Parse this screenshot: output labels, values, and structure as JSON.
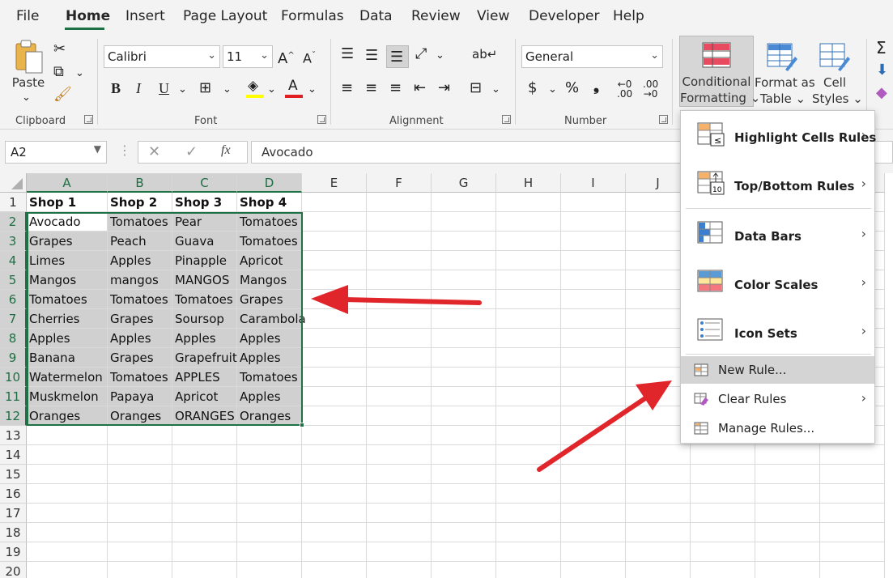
{
  "tabs": [
    "File",
    "Home",
    "Insert",
    "Page Layout",
    "Formulas",
    "Data",
    "Review",
    "View",
    "Developer",
    "Help"
  ],
  "ribbon": {
    "clipboard": {
      "label": "Clipboard",
      "paste": "Paste"
    },
    "font": {
      "label": "Font",
      "name": "Calibri",
      "size": "11",
      "bold": "B",
      "italic": "I",
      "underline": "U"
    },
    "alignment": {
      "label": "Alignment"
    },
    "number": {
      "label": "Number",
      "format": "General",
      "currency": "$",
      "percent": "%",
      "comma": "❟"
    },
    "styles": {
      "conditional_formatting": [
        "Conditional",
        "Formatting"
      ],
      "format_as_table": [
        "Format as",
        "Table"
      ],
      "cell_styles": [
        "Cell",
        "Styles"
      ]
    }
  },
  "formula_bar": {
    "name_box": "A2",
    "fx": "fx",
    "content": "Avocado"
  },
  "columns": [
    "A",
    "B",
    "C",
    "D",
    "E",
    "F",
    "G",
    "H",
    "I",
    "J"
  ],
  "rows": [
    "1",
    "2",
    "3",
    "4",
    "5",
    "6",
    "7",
    "8",
    "9",
    "10",
    "11",
    "12",
    "13",
    "14",
    "15",
    "16",
    "17",
    "18",
    "19",
    "20"
  ],
  "sheet": {
    "header": [
      "Shop 1",
      "Shop 2",
      "Shop 3",
      "Shop 4"
    ],
    "data": [
      [
        "Avocado",
        "Tomatoes",
        "Pear",
        "Tomatoes"
      ],
      [
        "Grapes",
        "Peach",
        "Guava",
        "Tomatoes"
      ],
      [
        "Limes",
        "Apples",
        "Pinapple",
        "Apricot"
      ],
      [
        "Mangos",
        "mangos",
        "MANGOS",
        "Mangos"
      ],
      [
        "Tomatoes",
        "Tomatoes",
        "Tomatoes",
        "Grapes"
      ],
      [
        "Cherries",
        "Grapes",
        "Soursop",
        "Carambola"
      ],
      [
        "Apples",
        "Apples",
        "Apples",
        "Apples"
      ],
      [
        "Banana",
        "Grapes",
        "Grapefruit",
        "Apples"
      ],
      [
        "Watermelon",
        "Tomatoes",
        "APPLES",
        "Tomatoes"
      ],
      [
        "Muskmelon",
        "Papaya",
        "Apricot",
        "Apples"
      ],
      [
        "Oranges",
        "Oranges",
        "ORANGES",
        "Oranges"
      ]
    ]
  },
  "cf_menu": {
    "main_items": [
      "Highlight Cells Rules",
      "Top/Bottom Rules",
      "Data Bars",
      "Color Scales",
      "Icon Sets"
    ],
    "new_rule": "New Rule...",
    "clear_rules": "Clear Rules",
    "manage_rules": "Manage Rules..."
  },
  "colors": {
    "excel_green": "#1e7145",
    "selection_fill": "#d0d0d0",
    "arrow_red": "#e0262b"
  }
}
